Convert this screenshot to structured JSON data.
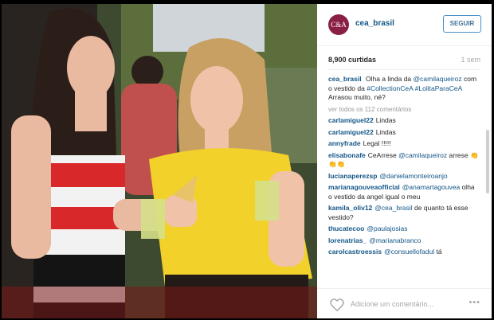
{
  "post": {
    "username": "cea_brasil",
    "avatar_text": "C&A",
    "follow_label": "SEGUIR",
    "likes": "8,900 curtidas",
    "time_ago": "1 sem",
    "view_all": "ver todos os 112 comentários",
    "add_comment_placeholder": "Adicione um comentário...",
    "more_label": "•••"
  },
  "caption": {
    "user": "cea_brasil",
    "text_1": "Olha a linda da",
    "mention": "@camilaqueiroz",
    "text_2": "com o vestido da",
    "hashtags": "#CollectionCeA #LolitaParaCeA",
    "text_3": "Arrasou muito, né?"
  },
  "comments": [
    {
      "user": "carlamiguel22",
      "text": "Lindas"
    },
    {
      "user": "carlamiguel22",
      "text": "Lindas"
    },
    {
      "user": "annyfrade",
      "text": "Legal !!!!!"
    },
    {
      "user": "elisabonafe",
      "text": "CeArrese",
      "mention": "@camilaqueiroz",
      "text2": "arrese 👏👏👏"
    },
    {
      "user": "lucianaperezsp",
      "mention": "@danielamonteiroanjo",
      "text": ""
    },
    {
      "user": "marianagouveaofficial",
      "mention": "@anamartagouvea",
      "text": "olha o vestido da angel igual o meu"
    },
    {
      "user": "kamila_oliv12",
      "mention": "@cea_brasil",
      "text": "de quanto tá esse vestido?"
    },
    {
      "user": "thucatecoo",
      "mention": "@paulajosias",
      "text": ""
    },
    {
      "user": "lorenatrias_",
      "mention": "@marianabranco",
      "text": ""
    },
    {
      "user": "carolcastroessis",
      "mention": "@consuellofadul",
      "text": "tá"
    }
  ],
  "colors": {
    "brand": "#8a1f45",
    "link": "#125688",
    "follow_border": "#4a90c8"
  },
  "icons": [
    "heart-icon",
    "more-icon"
  ]
}
